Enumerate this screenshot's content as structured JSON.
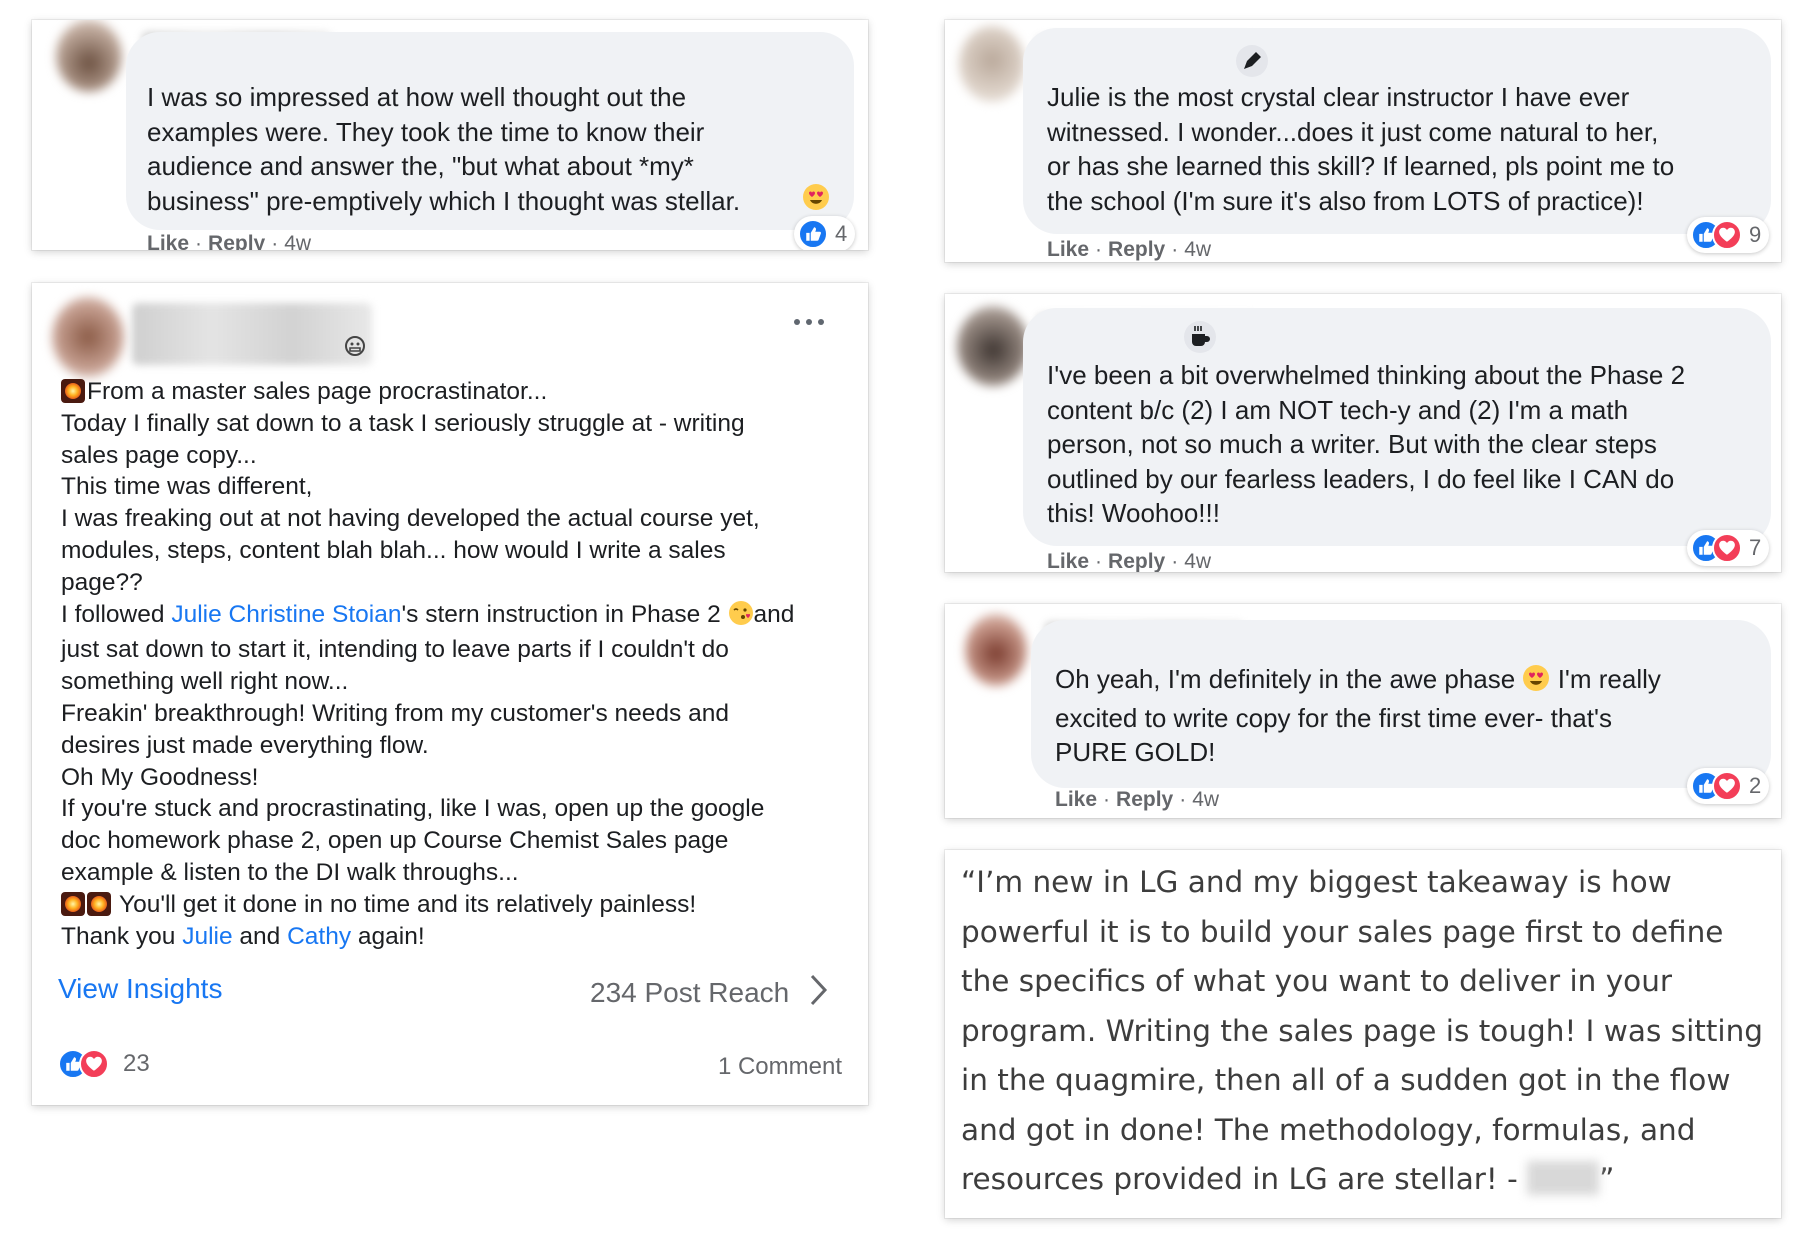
{
  "comment_1": {
    "text": "I was so impressed at how well thought out the\nexamples were. They took the time to know their\naudience and answer the, \"but what about *my*\nbusiness\" pre-emptively which I thought was stellar.",
    "actions": {
      "like": "Like",
      "reply": "Reply",
      "time": "4w"
    },
    "reaction_count": "4"
  },
  "post": {
    "lines": {
      "l1": "From a master sales page procrastinator...",
      "l2": "Today I finally sat down to a task I seriously struggle at - writing",
      "l3": "sales page copy...",
      "l4": "This time was different,",
      "l5": "I was freaking out at not having developed the actual course yet,",
      "l6": "modules, steps, content blah blah... how would I write a sales",
      "l7": "page??",
      "l8_pre": "I followed ",
      "l8_link": "Julie Christine Stoian",
      "l8_post": "'s stern instruction in Phase 2 ",
      "l8_end": "and",
      "l9": "just sat down to start it, intending to leave parts if I couldn't do",
      "l10": "something well right now...",
      "l11": "Freakin' breakthrough! Writing from my customer's needs and",
      "l12": "desires just made everything flow.",
      "l13": "Oh My Goodness!",
      "l14": "If you're stuck and procrastinating, like I was, open up the google",
      "l15": "doc homework phase 2, open up Course Chemist Sales page",
      "l16": "example & listen to the DI walk throughs...",
      "l17": "You'll get it done in no time and its relatively painless!",
      "l18_pre": "Thank you ",
      "l18_link1": "Julie",
      "l18_mid": " and ",
      "l18_link2": "Cathy",
      "l18_post": " again!"
    },
    "view_insights": "View Insights",
    "post_reach": "234 Post Reach",
    "reaction_count": "23",
    "comments": "1 Comment"
  },
  "comment_2": {
    "text": "Julie is the most crystal clear instructor I have ever\nwitnessed. I wonder...does it just come natural to her,\nor has she learned this skill? If learned, pls point me to\nthe school (I'm sure it's also from LOTS of practice)!",
    "actions": {
      "like": "Like",
      "reply": "Reply",
      "time": "4w"
    },
    "reaction_count": "9"
  },
  "comment_3": {
    "text": "I've been a bit overwhelmed thinking about the Phase 2\ncontent b/c (2) I am NOT tech-y and (2) I'm a math\nperson, not so much a writer. But with the clear steps\noutlined by our fearless leaders, I do feel like I CAN do\nthis! Woohoo!!!",
    "actions": {
      "like": "Like",
      "reply": "Reply",
      "time": "4w"
    },
    "reaction_count": "7"
  },
  "comment_4": {
    "line1_pre": "Oh yeah, I'm definitely in the awe phase ",
    "line1_post": " I'm really",
    "line2": "excited to write copy for the first time ever- that's",
    "line3": "PURE GOLD!",
    "actions": {
      "like": "Like",
      "reply": "Reply",
      "time": "4w"
    },
    "reaction_count": "2"
  },
  "quote": {
    "l1": "“I’m new in LG and my biggest takeaway is how",
    "l2": "powerful it is to build your sales page first to define",
    "l3": "the specifics of what you want to deliver in your",
    "l4": "program. Writing the sales page is tough! I was sitting",
    "l5": "in the quagmire, then all of a sudden got in the flow",
    "l6": "and got in done! The methodology, formulas, and",
    "l7_pre": "resources provided in LG are stellar! - ",
    "l7_post": "”"
  },
  "colors": {
    "link": "#1877f2",
    "bubble": "#f0f2f5",
    "like": "#1877f2",
    "love": "#f33e58",
    "meta": "#65676b"
  }
}
